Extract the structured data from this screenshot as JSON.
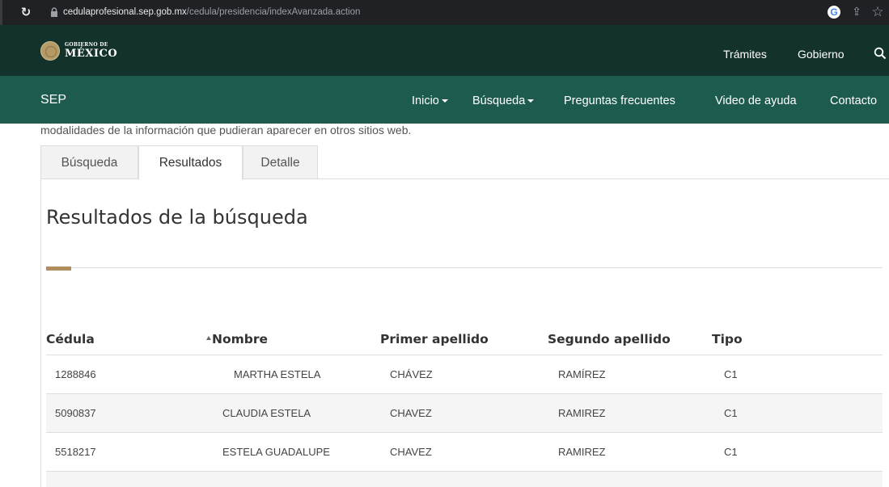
{
  "browser": {
    "url_host": "cedulaprofesional.sep.gob.mx",
    "url_path": "/cedula/presidencia/indexAvanzada.action"
  },
  "gob_header": {
    "logo_small": "GOBIERNO DE",
    "logo_big": "MÉXICO",
    "nav": [
      "Trámites",
      "Gobierno"
    ]
  },
  "sep_nav": {
    "title": "SEP",
    "items": [
      "Inicio",
      "Búsqueda",
      "Preguntas frecuentes",
      "Video de ayuda",
      "Contacto"
    ]
  },
  "clipped_text": "modalidades de la información que pudieran aparecer en otros sitios web.",
  "tabs": [
    "Búsqueda",
    "Resultados",
    "Detalle"
  ],
  "active_tab": "Resultados",
  "results_title": "Resultados de la búsqueda",
  "table": {
    "headers": [
      "Cédula",
      "Nombre",
      "Primer apellido",
      "Segundo apellido",
      "Tipo"
    ],
    "rows": [
      [
        "1288846",
        "MARTHA ESTELA",
        "CHÁVEZ",
        "RAMÍREZ",
        "C1"
      ],
      [
        "5090837",
        "CLAUDIA ESTELA",
        "CHAVEZ",
        "RAMIREZ",
        "C1"
      ],
      [
        "5518217",
        "ESTELA GUADALUPE",
        "CHAVEZ",
        "RAMIREZ",
        "C1"
      ]
    ]
  },
  "colors": {
    "gob_header_bg": "#13322b",
    "sep_bar_bg": "#1e5b4f",
    "accent": "#b38e5d"
  }
}
